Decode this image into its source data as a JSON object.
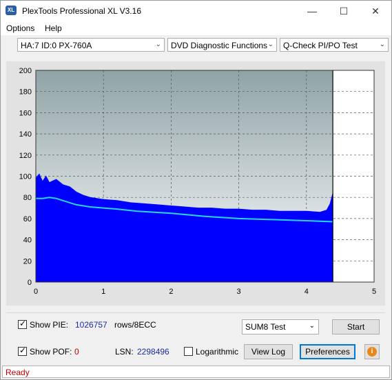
{
  "window": {
    "title": "PlexTools Professional XL V3.16",
    "icon_text": "XL"
  },
  "menu": {
    "options": "Options",
    "help": "Help"
  },
  "toolbar": {
    "drive": "HA:7 ID:0  PX-760A",
    "function": "DVD Diagnostic Functions",
    "test": "Q-Check PI/PO Test"
  },
  "chart_data": {
    "type": "area",
    "ylim": [
      0,
      200
    ],
    "xlim": [
      0,
      5
    ],
    "y_ticks": [
      "0",
      "20",
      "40",
      "60",
      "80",
      "100",
      "120",
      "140",
      "160",
      "180",
      "200"
    ],
    "x_ticks": [
      "0",
      "1",
      "2",
      "3",
      "4",
      "5"
    ],
    "grid": true,
    "data_end_x": 4.39,
    "series": [
      {
        "color": "#0000ff",
        "x": [
          0,
          0.05,
          0.1,
          0.15,
          0.2,
          0.3,
          0.4,
          0.5,
          0.6,
          0.7,
          0.8,
          1.0,
          1.2,
          1.4,
          1.6,
          1.8,
          2.0,
          2.2,
          2.4,
          2.6,
          2.8,
          3.0,
          3.2,
          3.4,
          3.6,
          3.8,
          4.0,
          4.2,
          4.3,
          4.35,
          4.39
        ],
        "values": [
          98,
          102,
          95,
          100,
          94,
          97,
          92,
          90,
          85,
          82,
          80,
          78,
          77,
          75,
          74,
          73,
          72,
          71,
          70,
          70,
          69,
          69,
          68,
          68,
          67,
          67,
          67,
          66,
          68,
          74,
          84
        ]
      },
      {
        "color": "#23d9e3",
        "x": [
          0,
          0.1,
          0.2,
          0.3,
          0.4,
          0.5,
          0.6,
          0.8,
          1.0,
          1.2,
          1.5,
          2.0,
          2.5,
          3.0,
          3.5,
          4.0,
          4.39
        ],
        "values": [
          79,
          79,
          80,
          79,
          77,
          75,
          73,
          71,
          70,
          69,
          67,
          65,
          62,
          60,
          59,
          58,
          57
        ]
      }
    ]
  },
  "controls": {
    "show_pie_label": "Show PIE:",
    "pie_value": "1026757",
    "pie_unit": "rows/8ECC",
    "show_pof_label": "Show POF:",
    "pof_value": "0",
    "lsn_label": "LSN:",
    "lsn_value": "2298496",
    "logarithmic_label": "Logarithmic",
    "test_mode": "SUM8 Test",
    "start_label": "Start",
    "view_log_label": "View Log",
    "preferences_label": "Preferences"
  },
  "status": {
    "text": "Ready"
  }
}
